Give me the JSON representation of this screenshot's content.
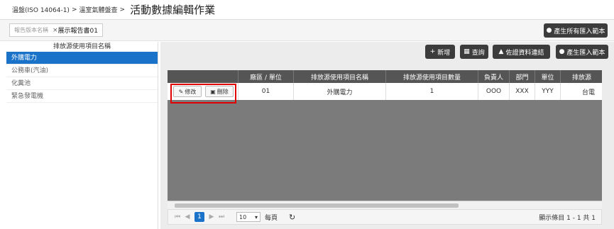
{
  "breadcrumb": {
    "item1": "溫盤(ISO 14064-1)",
    "sep": ">",
    "item2": "溫室氣體盤查"
  },
  "page_title": "活動數據編輯作業",
  "report_select": {
    "placeholder": "報告版本名稱",
    "clear": "×",
    "value": "展示報告書01"
  },
  "buttons": {
    "gen_all": "產生所有匯入範本",
    "add": "新增",
    "query": "查詢",
    "evidence": "佐證資料連結",
    "gen_import": "產生匯入範本"
  },
  "sidebar": {
    "header": "排放源使用項目名稱",
    "items": [
      "外購電力",
      "公務車(汽油)",
      "化糞池",
      "緊急發電機"
    ]
  },
  "table": {
    "columns": [
      "",
      "廠區 / 單位",
      "排放源使用項目名稱",
      "排放源使用項目數量",
      "負責人",
      "部門",
      "單位",
      "排放源"
    ],
    "row": {
      "edit": "修改",
      "delete": "刪除",
      "site": "01",
      "name": "外購電力",
      "qty": "1",
      "owner": "OOO",
      "dept": "XXX",
      "unit": "YYY",
      "src": "台電"
    }
  },
  "pager": {
    "first": "⏮",
    "prev": "◀",
    "current": "1",
    "next": "▶",
    "last": "⏭",
    "page_size": "10",
    "per_page_label": "每頁",
    "refresh": "↻",
    "info": "顯示條目 1 - 1 共 1"
  },
  "colors": {
    "accent": "#1a73c9",
    "highlight": "#e00000",
    "dark_button": "#3c3c3c"
  }
}
